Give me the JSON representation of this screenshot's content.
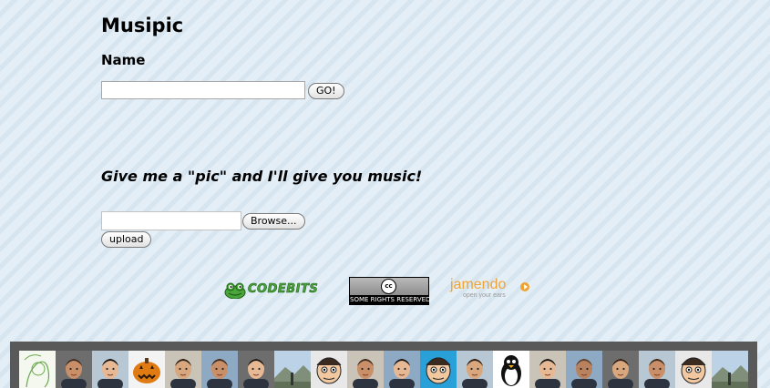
{
  "app": {
    "title": "Musipic"
  },
  "search": {
    "label": "Name",
    "value": "",
    "placeholder": "",
    "go_label": "GO!"
  },
  "upload": {
    "tagline": "Give me a \"pic\" and I'll give you music!",
    "browse_label": "Browse...",
    "upload_label": "upload"
  },
  "logos": {
    "codebits": "CODEBITS",
    "creative_commons": {
      "symbol": "cc",
      "caption": "SOME RIGHTS RESERVED"
    },
    "jamendo": {
      "name": "jamendo",
      "tagline": "open your ears"
    }
  },
  "colors": {
    "background": "#dde9f2",
    "bar": "#595959",
    "codebits_green": "#4aa53a",
    "jamendo_orange": "#f0a233"
  },
  "avatars": [
    {
      "kind": "sketch"
    },
    {
      "kind": "person"
    },
    {
      "kind": "person"
    },
    {
      "kind": "pumpkin"
    },
    {
      "kind": "person"
    },
    {
      "kind": "person"
    },
    {
      "kind": "person"
    },
    {
      "kind": "landscape"
    },
    {
      "kind": "cartoon"
    },
    {
      "kind": "person"
    },
    {
      "kind": "person"
    },
    {
      "kind": "cartoon"
    },
    {
      "kind": "person"
    },
    {
      "kind": "penguin"
    },
    {
      "kind": "person"
    },
    {
      "kind": "person"
    },
    {
      "kind": "person"
    },
    {
      "kind": "person"
    },
    {
      "kind": "cartoon"
    },
    {
      "kind": "landscape"
    }
  ]
}
